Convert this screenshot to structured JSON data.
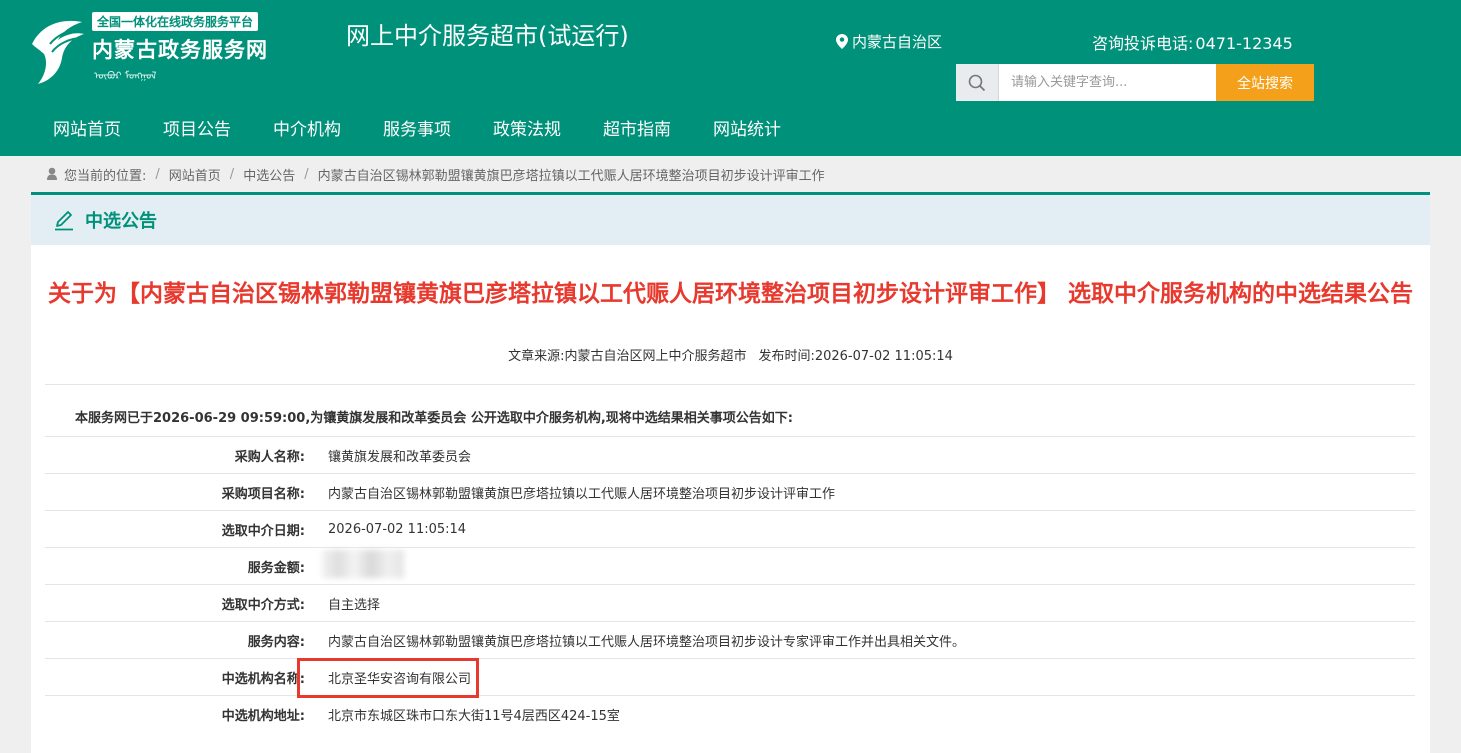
{
  "header": {
    "platform_label": "全国一体化在线政务服务平台",
    "site_name": "内蒙古政务服务网",
    "mongol_script": "ᠥᠪᠥᠷ ᠮᠣᠩᠭᠣᠯ",
    "market_title": "网上中介服务超市(试运行)",
    "location": "内蒙古自治区",
    "hotline_label": "咨询投诉电话:",
    "hotline_number": "0471-12345",
    "search_placeholder": "请输入关键字查询...",
    "search_button": "全站搜索"
  },
  "nav": {
    "items": [
      {
        "label": "网站首页"
      },
      {
        "label": "项目公告"
      },
      {
        "label": "中介机构"
      },
      {
        "label": "服务事项"
      },
      {
        "label": "政策法规"
      },
      {
        "label": "超市指南"
      },
      {
        "label": "网站统计"
      }
    ]
  },
  "breadcrumb": {
    "prefix": "您当前的位置:",
    "items": [
      {
        "label": "网站首页"
      },
      {
        "label": "中选公告"
      },
      {
        "label": "内蒙古自治区锡林郭勒盟镶黄旗巴彦塔拉镇以工代赈人居环境整治项目初步设计评审工作"
      }
    ]
  },
  "section": {
    "title": "中选公告"
  },
  "notice": {
    "title": "关于为【内蒙古自治区锡林郭勒盟镶黄旗巴彦塔拉镇以工代赈人居环境整治项目初步设计评审工作】 选取中介服务机构的中选结果公告",
    "source": "文章来源:内蒙古自治区网上中介服务超市",
    "publish_time": "发布时间:2026-07-02 11:05:14",
    "intro": "本服务网已于2026-06-29 09:59:00,为镶黄旗发展和改革委员会 公开选取中介服务机构,现将中选结果相关事项公告如下:",
    "rows": [
      {
        "label": "采购人名称:",
        "value": "镶黄旗发展和改革委员会"
      },
      {
        "label": "采购项目名称:",
        "value": "内蒙古自治区锡林郭勒盟镶黄旗巴彦塔拉镇以工代赈人居环境整治项目初步设计评审工作"
      },
      {
        "label": "选取中介日期:",
        "value": "2026-07-02 11:05:14"
      },
      {
        "label": "服务金额:",
        "value": ""
      },
      {
        "label": "选取中介方式:",
        "value": "自主选择"
      },
      {
        "label": "服务内容:",
        "value": "内蒙古自治区锡林郭勒盟镶黄旗巴彦塔拉镇以工代赈人居环境整治项目初步设计专家评审工作并出具相关文件。"
      },
      {
        "label": "中选机构名称:",
        "value": "北京圣华安咨询有限公司"
      },
      {
        "label": "中选机构地址:",
        "value": "北京市东城区珠市口东大街11号4层西区424-15室"
      }
    ]
  },
  "colors": {
    "brand_green": "#00917a",
    "search_orange": "#f5a01a",
    "title_red": "#e8392e",
    "highlight_red": "#e8392e"
  }
}
